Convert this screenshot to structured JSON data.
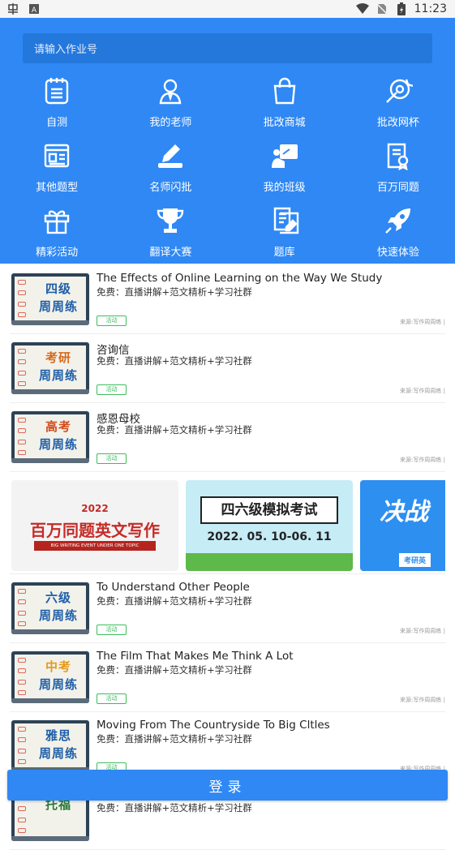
{
  "status_bar": {
    "time": "11:23"
  },
  "search": {
    "placeholder": "请输入作业号"
  },
  "grid": [
    [
      {
        "label": "自测",
        "icon": "notebook-icon"
      },
      {
        "label": "我的老师",
        "icon": "teacher-icon"
      },
      {
        "label": "批改商城",
        "icon": "shopping-bag-icon"
      },
      {
        "label": "批改网杯",
        "icon": "target-icon"
      }
    ],
    [
      {
        "label": "其他题型",
        "icon": "webpage-icon"
      },
      {
        "label": "名师闪批",
        "icon": "writing-hand-icon"
      },
      {
        "label": "我的班级",
        "icon": "classroom-icon"
      },
      {
        "label": "百万同题",
        "icon": "certificate-icon"
      }
    ],
    [
      {
        "label": "精彩活动",
        "icon": "gift-icon"
      },
      {
        "label": "翻译大赛",
        "icon": "trophy-icon"
      },
      {
        "label": "题库",
        "icon": "documents-icon"
      },
      {
        "label": "快速体验",
        "icon": "rocket-icon"
      }
    ]
  ],
  "list_top": [
    {
      "title": "The Effects of Online Learning on the Way We Study",
      "subtitle": "免费：直播讲解+范文精析+学习社群",
      "tag": "活动",
      "source": "来源:写作周周练 |",
      "thumb_line1": "四级",
      "thumb_line2": "周周练",
      "thumb_color": "#1f5ea8"
    },
    {
      "title": "咨询信",
      "subtitle": "免费：直播讲解+范文精析+学习社群",
      "tag": "活动",
      "source": "来源:写作周周练 |",
      "thumb_line1": "考研",
      "thumb_line2": "周周练",
      "thumb_color": "#d66a1e"
    },
    {
      "title": "感恩母校",
      "subtitle": "免费：直播讲解+范文精析+学习社群",
      "tag": "活动",
      "source": "来源:写作周周练 |",
      "thumb_line1": "高考",
      "thumb_line2": "周周练",
      "thumb_color": "#d34a1a"
    }
  ],
  "banners": {
    "b1": {
      "year": "2022",
      "title": "百万同题英文写作",
      "strip": "BIG WRITING EVENT UNDER ONE TOPIC"
    },
    "b2": {
      "title": "四六级模拟考试",
      "date": "2022. 05. 10-06. 11"
    },
    "b3": {
      "title": "决战",
      "ribbon": "考研英"
    }
  },
  "list_bottom": [
    {
      "title": "To Understand Other People",
      "subtitle": "免费：直播讲解+范文精析+学习社群",
      "tag": "活动",
      "source": "来源:写作周周练 |",
      "thumb_line1": "六级",
      "thumb_line2": "周周练",
      "thumb_color": "#1f5ea8"
    },
    {
      "title": "The Film That Makes Me Think A Lot",
      "subtitle": "免费：直播讲解+范文精析+学习社群",
      "tag": "活动",
      "source": "来源:写作周周练 |",
      "thumb_line1": "中考",
      "thumb_line2": "周周练",
      "thumb_color": "#e39a1a"
    },
    {
      "title": "Moving From The Countryside To Big Cltles",
      "subtitle": "免费：直播讲解+范文精析+学习社群",
      "tag": "活动",
      "source": "来源:写作周周练 |",
      "thumb_line1": "雅思",
      "thumb_line2": "周周练",
      "thumb_color": "#1f5ea8"
    },
    {
      "title": "",
      "subtitle": "免费：直播讲解+范文精析+学习社群",
      "tag": "",
      "source": "",
      "thumb_line1": "托福",
      "thumb_line2": "",
      "thumb_color": "#2c7a3a"
    }
  ],
  "login": {
    "label": "登录"
  }
}
